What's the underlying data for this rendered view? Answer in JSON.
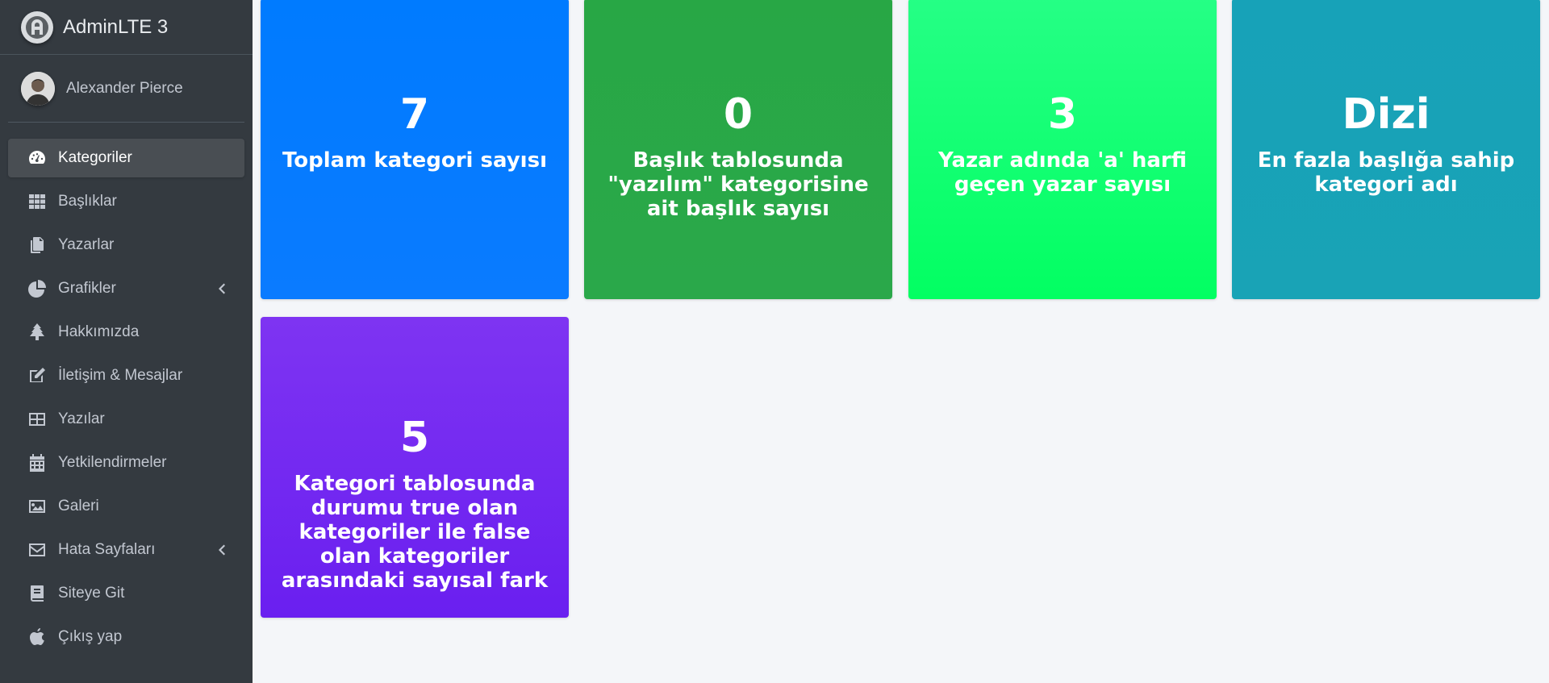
{
  "brand": {
    "title": "AdminLTE 3"
  },
  "user": {
    "name": "Alexander Pierce"
  },
  "sidebar": {
    "items": [
      {
        "label": "Kategoriler",
        "icon": "tachometer-icon",
        "active": true
      },
      {
        "label": "Başlıklar",
        "icon": "grid-icon"
      },
      {
        "label": "Yazarlar",
        "icon": "copy-icon"
      },
      {
        "label": "Grafikler",
        "icon": "pie-chart-icon",
        "has_submenu": true
      },
      {
        "label": "Hakkımızda",
        "icon": "tree-icon"
      },
      {
        "label": "İletişim & Mesajlar",
        "icon": "edit-icon"
      },
      {
        "label": "Yazılar",
        "icon": "table-icon"
      },
      {
        "label": "Yetkilendirmeler",
        "icon": "calendar-icon"
      },
      {
        "label": "Galeri",
        "icon": "image-icon"
      },
      {
        "label": "Hata Sayfaları",
        "icon": "envelope-icon",
        "has_submenu": true
      },
      {
        "label": "Siteye Git",
        "icon": "book-icon"
      },
      {
        "label": "Çıkış yap",
        "icon": "apple-icon"
      }
    ]
  },
  "cards": [
    {
      "value": "7",
      "label": "Toplam kategori sayısı",
      "color": "#007bff"
    },
    {
      "value": "0",
      "label": "Başlık tablosunda \"yazılım\" kategorisine ait başlık sayısı",
      "color": "#28a745"
    },
    {
      "value": "3",
      "label": "Yazar adında 'a' harfi geçen yazar sayısı",
      "color": "#1aff7c"
    },
    {
      "value": "Dizi",
      "label": "En fazla başlığa sahip kategori adı",
      "color": "#17a2b8"
    },
    {
      "value": "5",
      "label": "Kategori tablosunda durumu true olan kategoriler ile false olan kategoriler arasındaki sayısal fark",
      "color": "#7b2ff2"
    }
  ]
}
